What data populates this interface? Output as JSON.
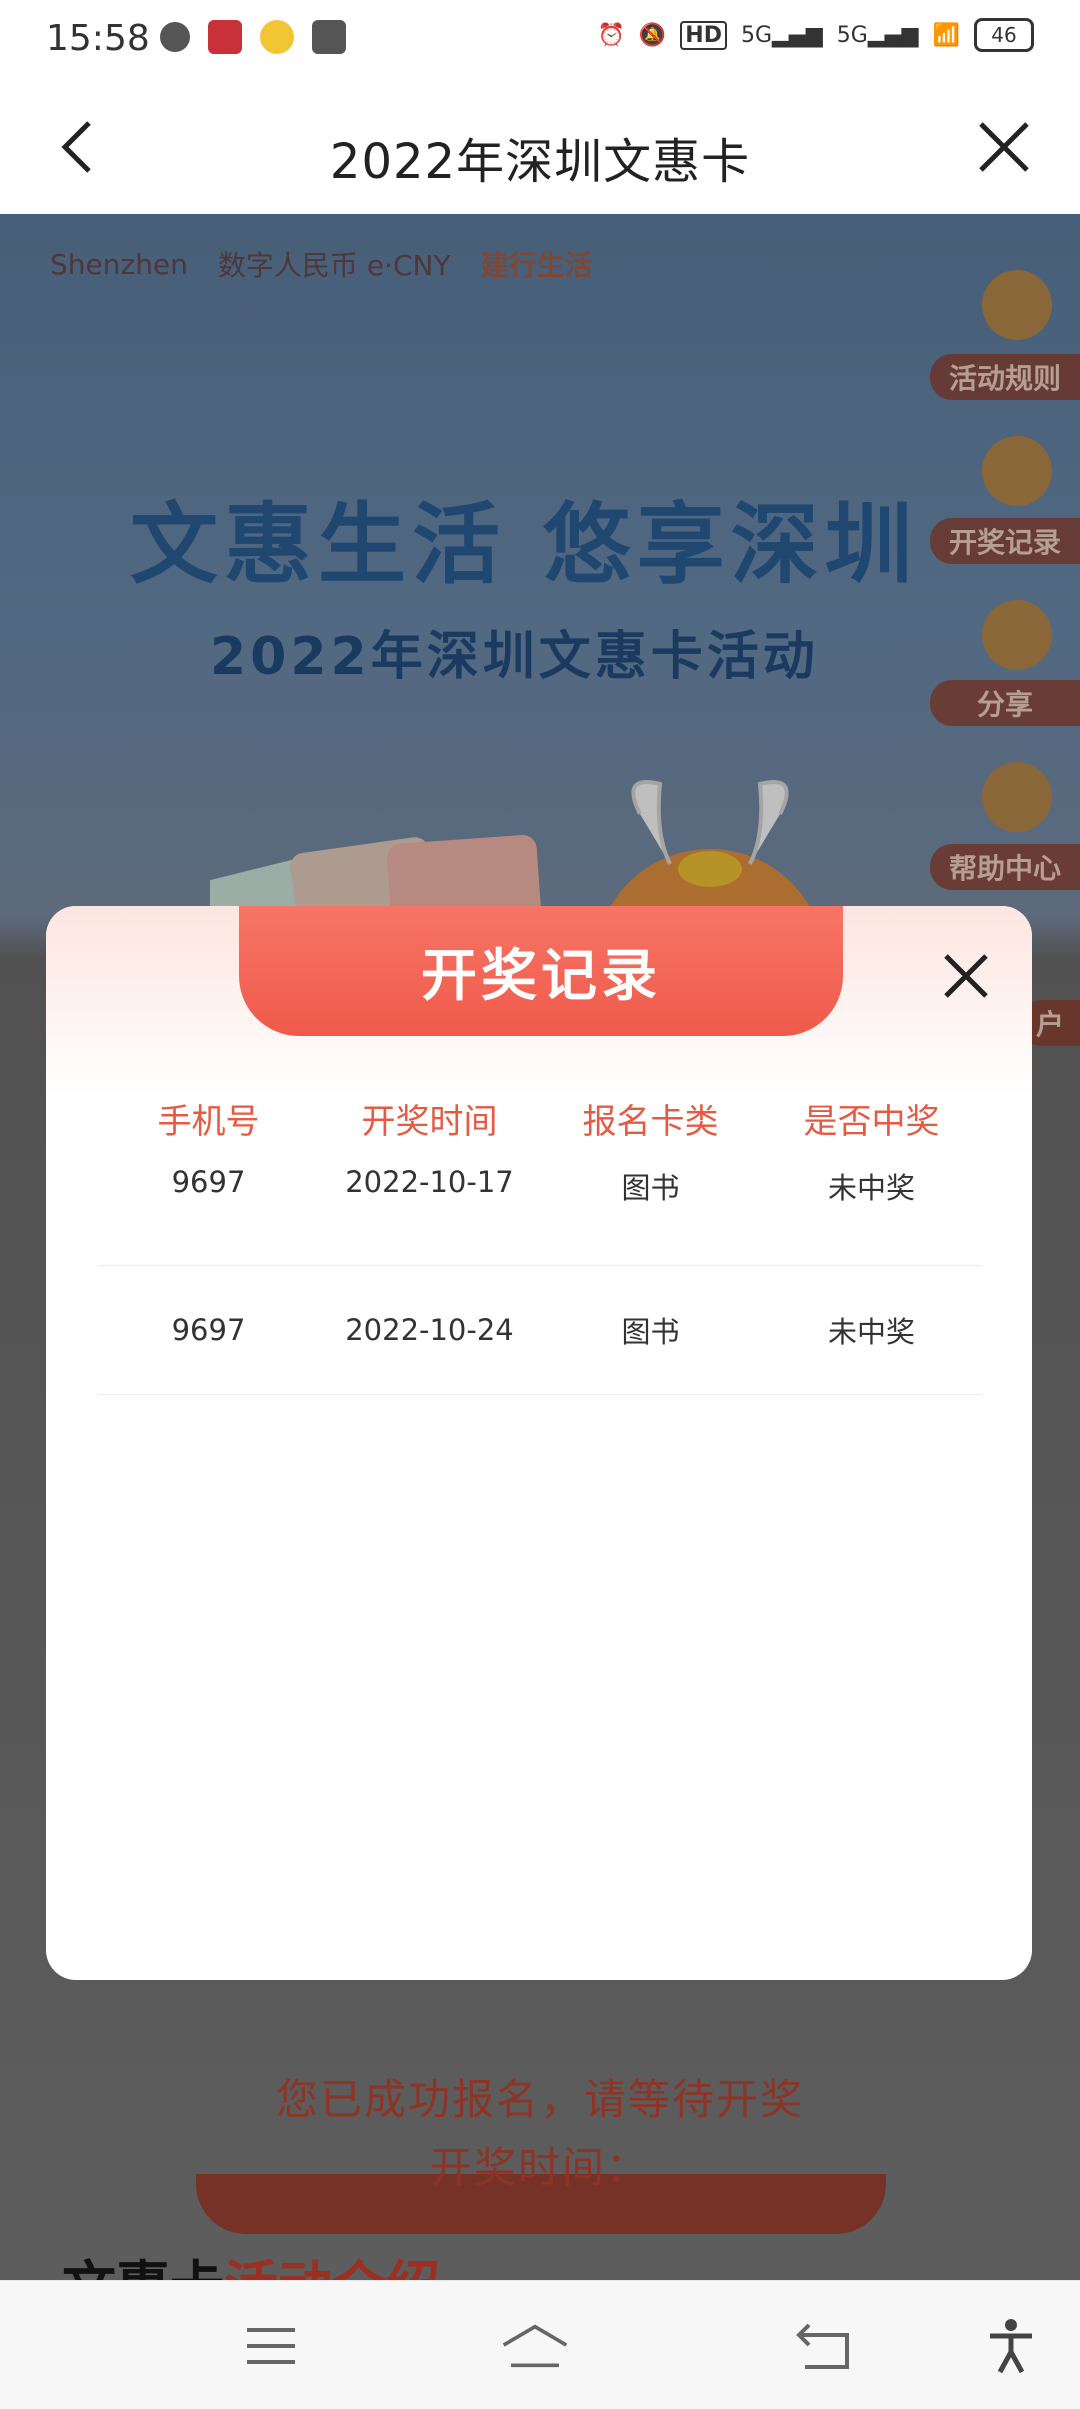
{
  "status_bar": {
    "time": "15:58",
    "network_left": "5G",
    "network_right": "5G",
    "battery": "46",
    "hd_label": "HD"
  },
  "header": {
    "title": "2022年深圳文惠卡"
  },
  "background": {
    "logos": [
      "Shenzhen",
      "数字人民币 e·CNY",
      "建行生活"
    ],
    "banner_title": "文惠生活  悠享深圳",
    "banner_sub": "2022年深圳文惠卡活动",
    "side_menu": [
      "活动规则",
      "开奖记录",
      "分享",
      "帮助中心",
      "户"
    ],
    "status_text": "您已成功报名，请等待开奖",
    "draw_time_label": "开奖时间：",
    "intro_heading_a": "文惠卡",
    "intro_heading_b": "活动介绍"
  },
  "modal": {
    "title": "开奖记录",
    "columns": [
      "手机号",
      "开奖时间",
      "报名卡类",
      "是否中奖"
    ],
    "rows": [
      {
        "phone": "9697",
        "date": "2022-10-17",
        "card": "图书",
        "result": "未中奖"
      },
      {
        "phone": "9697",
        "date": "2022-10-24",
        "card": "图书",
        "result": "未中奖"
      }
    ]
  },
  "colors": {
    "accent": "#ef5a4a",
    "header_text": "#e45a43"
  },
  "nav": {
    "icons": [
      "menu-icon",
      "home-icon",
      "back-icon",
      "accessibility-icon"
    ]
  }
}
